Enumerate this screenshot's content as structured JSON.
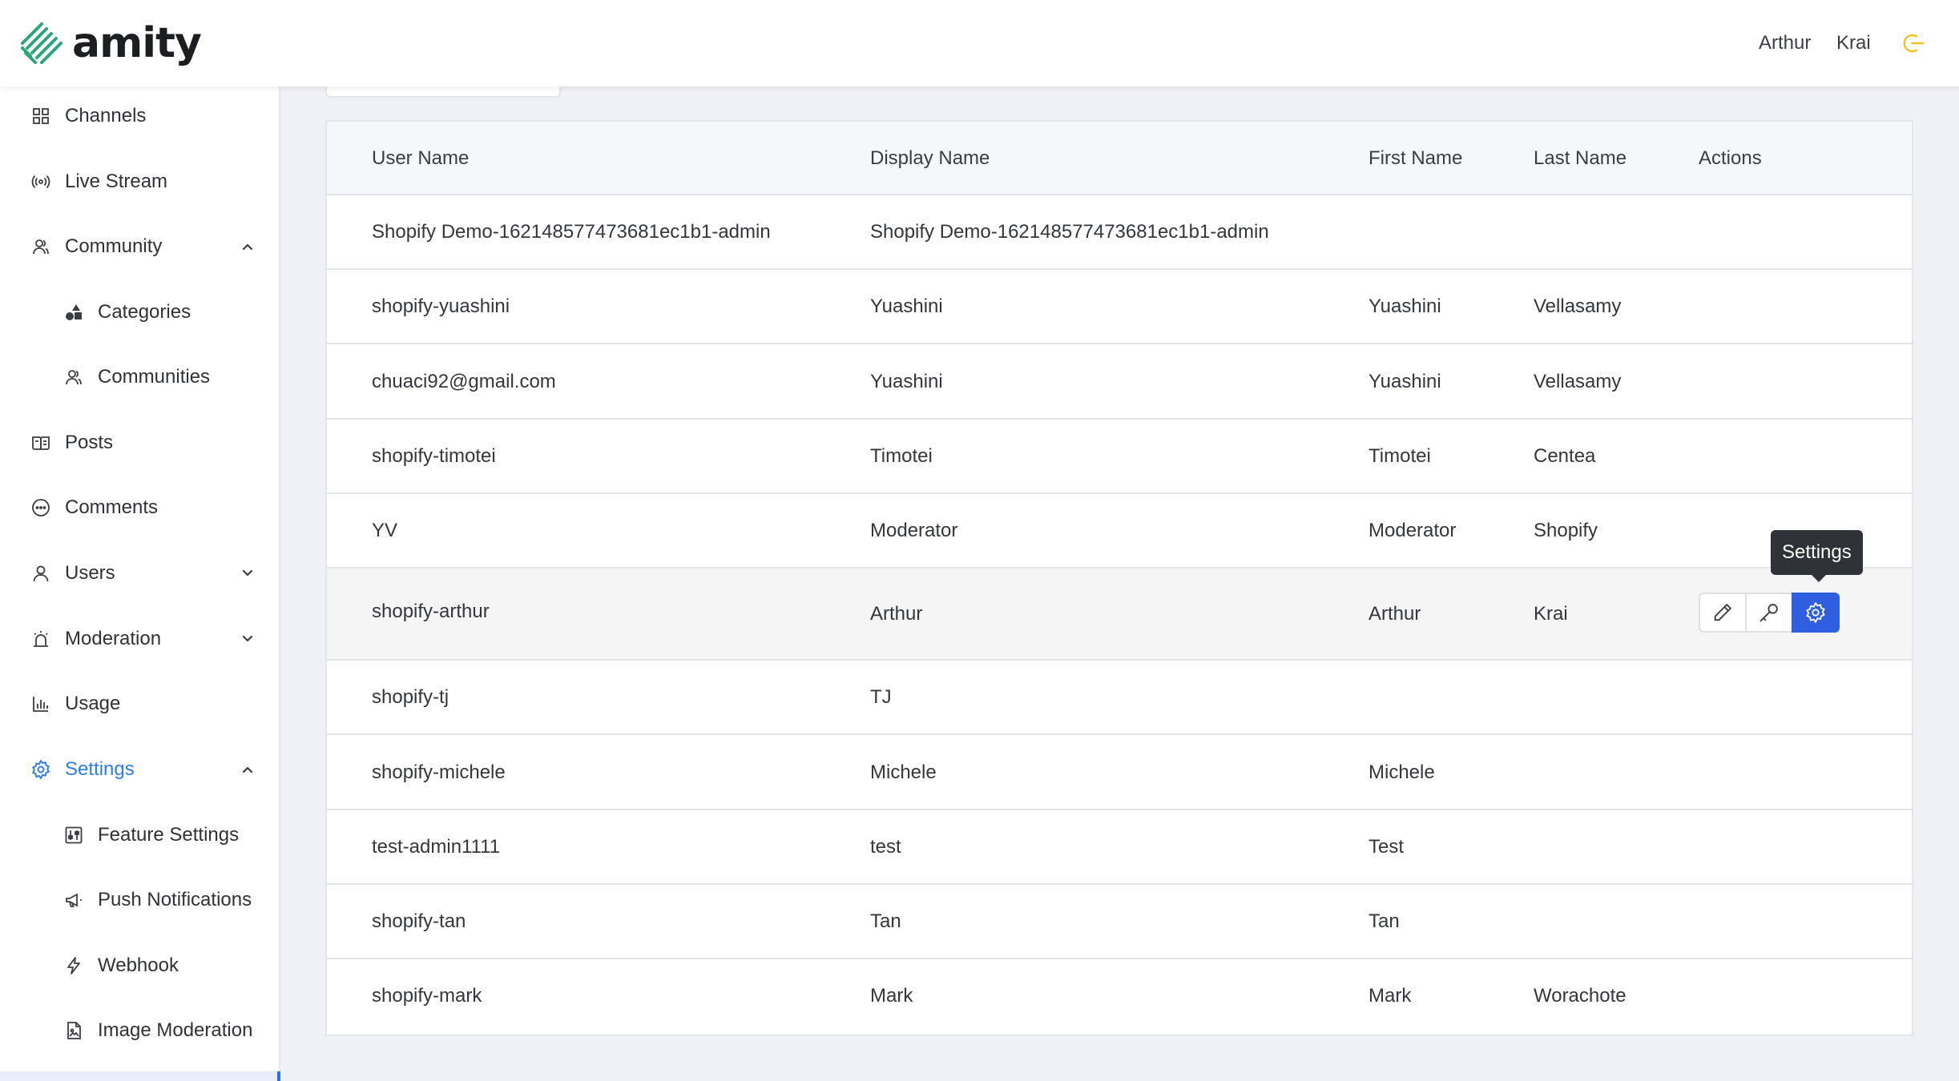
{
  "app": {
    "brand": "amity"
  },
  "header": {
    "user_first": "Arthur",
    "user_last": "Krai"
  },
  "colors": {
    "accent": "#2e7ee8",
    "brand_green": "#2aa776",
    "logout": "#f2c21b",
    "primary_button": "#2f5fe0"
  },
  "sidebar": {
    "items": [
      {
        "label": "Channels",
        "icon": "grid-icon"
      },
      {
        "label": "Live Stream",
        "icon": "broadcast-icon"
      },
      {
        "label": "Community",
        "icon": "community-icon",
        "expanded": true
      },
      {
        "label": "Categories",
        "icon": "shapes-icon"
      },
      {
        "label": "Communities",
        "icon": "people-icon"
      },
      {
        "label": "Posts",
        "icon": "book-icon"
      },
      {
        "label": "Comments",
        "icon": "chat-bubble-icon"
      },
      {
        "label": "Users",
        "icon": "user-icon",
        "expanded": false
      },
      {
        "label": "Moderation",
        "icon": "alarm-icon",
        "expanded": false
      },
      {
        "label": "Usage",
        "icon": "bar-chart-icon"
      },
      {
        "label": "Settings",
        "icon": "gear-icon",
        "expanded": true,
        "active": true
      },
      {
        "label": "Feature Settings",
        "icon": "sliders-icon"
      },
      {
        "label": "Push Notifications",
        "icon": "megaphone-icon"
      },
      {
        "label": "Webhook",
        "icon": "bolt-icon"
      },
      {
        "label": "Image Moderation",
        "icon": "file-image-icon"
      }
    ]
  },
  "table": {
    "columns": [
      "User Name",
      "Display Name",
      "First Name",
      "Last Name",
      "Actions"
    ],
    "rows": [
      [
        "Shopify Demo-162148577473681ec1b1-admin",
        "Shopify Demo-162148577473681ec1b1-admin",
        "",
        ""
      ],
      [
        "shopify-yuashini",
        "Yuashini",
        "Yuashini",
        "Vellasamy"
      ],
      [
        "chuaci92@gmail.com",
        "Yuashini",
        "Yuashini",
        "Vellasamy"
      ],
      [
        "shopify-timotei",
        "Timotei",
        "Timotei",
        "Centea"
      ],
      [
        "YV",
        "Moderator",
        "Moderator",
        "Shopify"
      ],
      [
        "shopify-arthur",
        "Arthur",
        "Arthur",
        "Krai"
      ],
      [
        "shopify-tj",
        "TJ",
        "",
        ""
      ],
      [
        "shopify-michele",
        "Michele",
        "Michele",
        ""
      ],
      [
        "test-admin1111",
        "test",
        "Test",
        ""
      ],
      [
        "shopify-tan",
        "Tan",
        "Tan",
        ""
      ],
      [
        "shopify-mark",
        "Mark",
        "Mark",
        "Worachote"
      ]
    ],
    "hovered_row": 5,
    "row_actions": [
      {
        "name": "edit",
        "icon": "pencil-icon"
      },
      {
        "name": "key",
        "icon": "key-icon"
      },
      {
        "name": "settings",
        "icon": "gear-icon"
      }
    ],
    "tooltip": "Settings"
  }
}
